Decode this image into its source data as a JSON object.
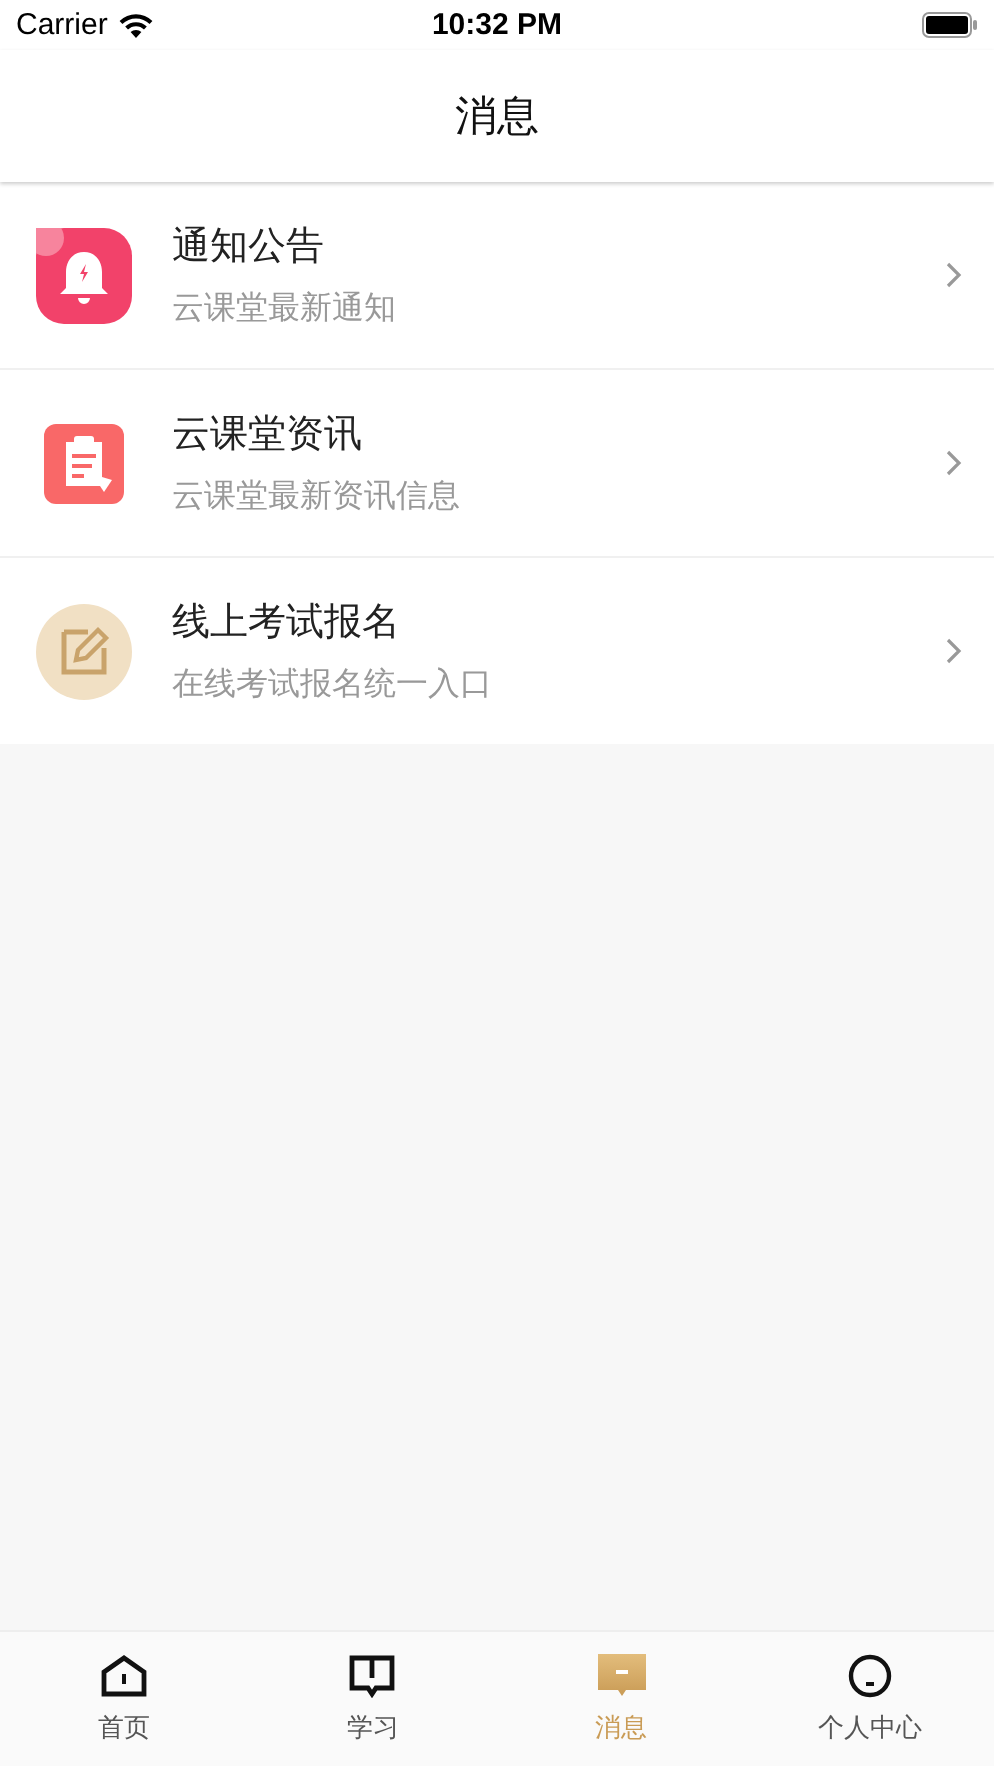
{
  "status_bar": {
    "carrier": "Carrier",
    "time": "10:32 PM"
  },
  "nav": {
    "title": "消息"
  },
  "messages": [
    {
      "kind": "bell",
      "title": "通知公告",
      "subtitle": "云课堂最新通知"
    },
    {
      "kind": "clipboard",
      "title": "云课堂资讯",
      "subtitle": "云课堂最新资讯信息"
    },
    {
      "kind": "pencil",
      "title": "线上考试报名",
      "subtitle": "在线考试报名统一入口"
    }
  ],
  "tabs": [
    {
      "kind": "home",
      "label": "首页",
      "selected": false
    },
    {
      "kind": "book",
      "label": "学习",
      "selected": false
    },
    {
      "kind": "message",
      "label": "消息",
      "selected": true
    },
    {
      "kind": "person",
      "label": "个人中心",
      "selected": false
    }
  ]
}
